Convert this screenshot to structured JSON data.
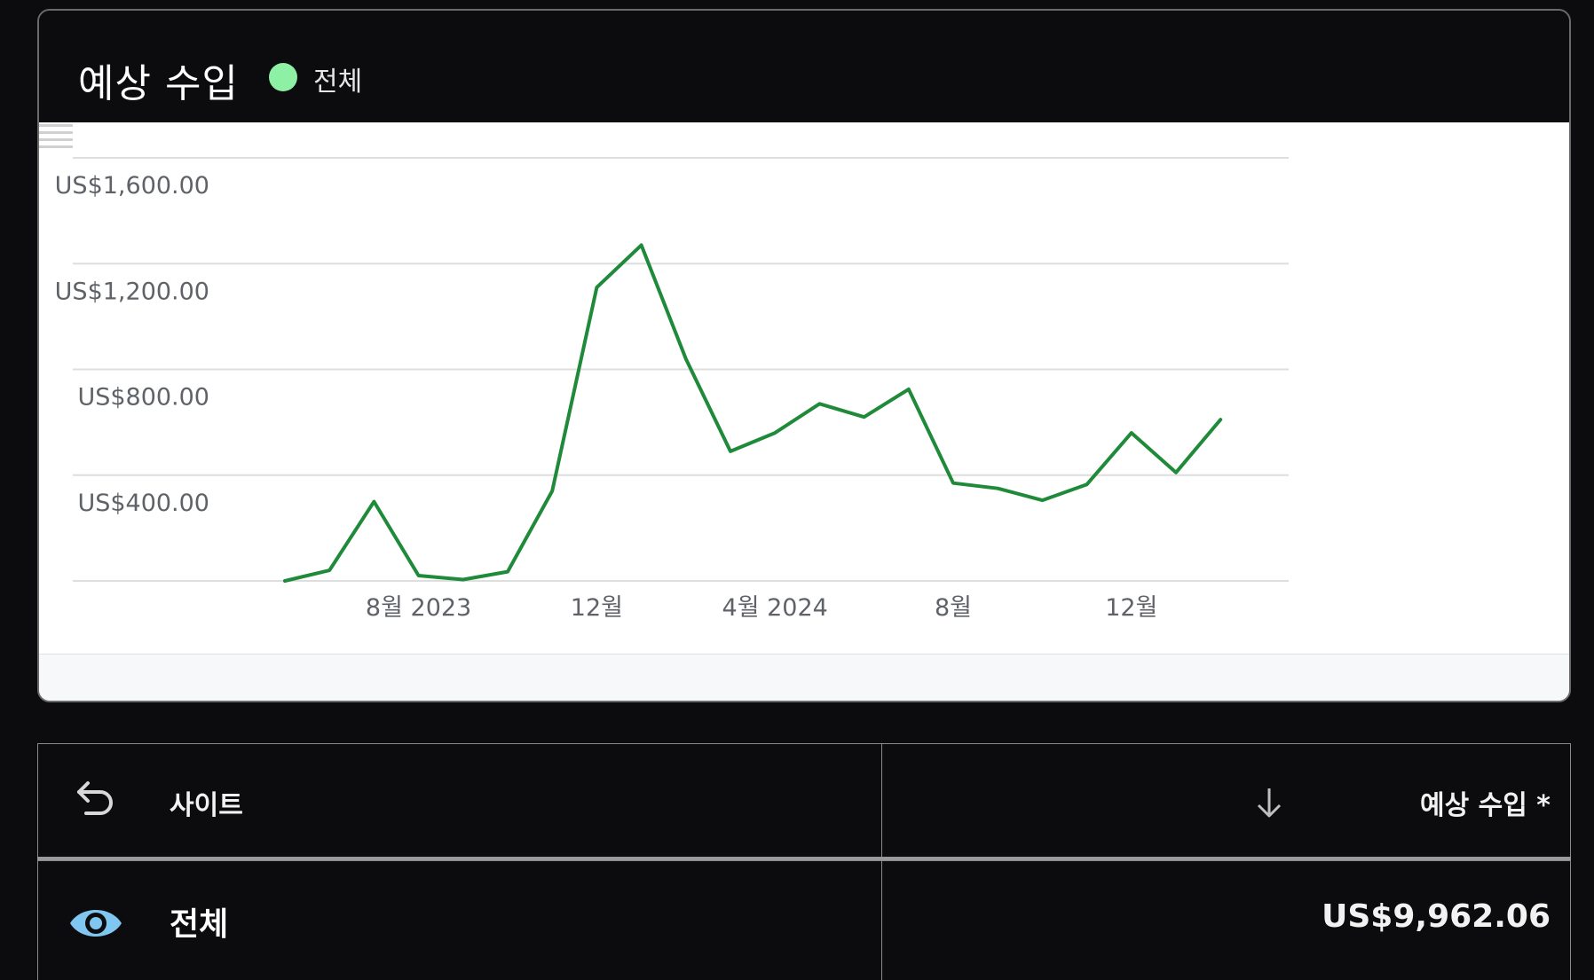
{
  "card": {
    "title": "예상 수입",
    "legend_label": "전체",
    "legend_color": "#8ef0a4",
    "line_color": "#1f8a3a"
  },
  "chart_data": {
    "type": "line",
    "yticks": [
      "US$400.00",
      "US$800.00",
      "US$1,200.00",
      "US$1,600.00"
    ],
    "ytick_values": [
      400,
      800,
      1200,
      1600
    ],
    "ylim": [
      0,
      1600
    ],
    "xtick_labels": [
      "8월 2023",
      "12월",
      "4월 2024",
      "8월",
      "12월"
    ],
    "xtick_positions": [
      "2023-08",
      "2023-12",
      "2024-04",
      "2024-08",
      "2024-12"
    ],
    "x": [
      "2023-05",
      "2023-06",
      "2023-07",
      "2023-08",
      "2023-09",
      "2023-10",
      "2023-11",
      "2023-12",
      "2024-01",
      "2024-02",
      "2024-03",
      "2024-04",
      "2024-05",
      "2024-06",
      "2024-07",
      "2024-08",
      "2024-09",
      "2024-10",
      "2024-11",
      "2024-12",
      "2025-01",
      "2025-02"
    ],
    "series": [
      {
        "values": [
          0,
          40,
          300,
          20,
          5,
          35,
          340,
          1110,
          1270,
          840,
          490,
          560,
          670,
          620,
          725,
          370,
          350,
          305,
          365,
          560,
          410,
          610
        ]
      }
    ]
  },
  "table": {
    "header_site": "사이트",
    "header_earnings": "예상 수입 *",
    "row_label": "전체",
    "row_value": "US$9,962.06"
  },
  "icons": {
    "back": "undo-arrow-icon",
    "sort": "arrow-down-icon",
    "eye": "eye-icon",
    "list": "list-icon"
  }
}
